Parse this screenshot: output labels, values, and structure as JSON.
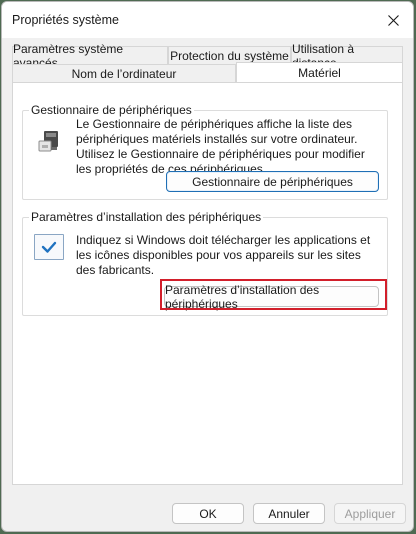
{
  "window": {
    "title": "Propriétés système",
    "close_icon": "close-icon"
  },
  "tabs": {
    "row_back": [
      "Paramètres système avancés",
      "Protection du système",
      "Utilisation à distance"
    ],
    "row_front": [
      "Nom de l’ordinateur",
      "Matériel"
    ],
    "active": "Matériel"
  },
  "device_manager": {
    "title": "Gestionnaire de périphériques",
    "description": "Le Gestionnaire de périphériques affiche la liste des périphériques matériels installés sur votre ordinateur. Utilisez le Gestionnaire de périphériques pour modifier les propriétés de ces périphériques.",
    "button_label": "Gestionnaire de périphériques",
    "icon": "device-manager-icon"
  },
  "install_settings": {
    "title": "Paramètres d’installation des périphériques",
    "description": "Indiquez si Windows doit télécharger les applications et les icônes disponibles pour vos appareils sur les sites des fabricants.",
    "button_label": "Paramètres d’installation des périphériques",
    "icon": "checkmark-icon"
  },
  "footer": {
    "ok_label": "OK",
    "cancel_label": "Annuler",
    "apply_label": "Appliquer"
  },
  "colors": {
    "highlight_box": "#d21f2b",
    "focus_border": "#1f6fb5"
  }
}
